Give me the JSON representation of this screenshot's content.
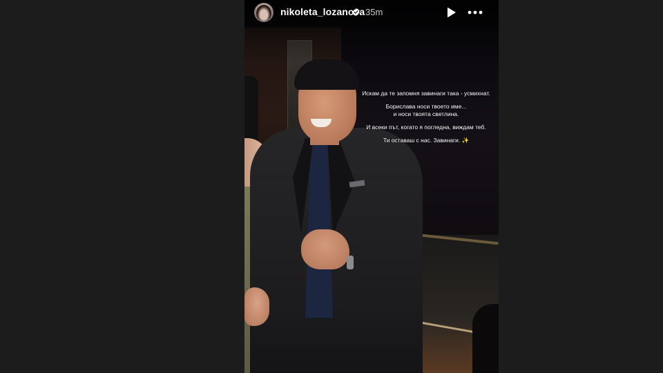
{
  "header": {
    "username": "nikoleta_lozanova",
    "verified_icon": "verified-badge-icon",
    "timestamp": "35m",
    "play_icon": "play-icon",
    "more_icon": "more-options-icon"
  },
  "caption": {
    "line1": "Искам да те запомня завинаги така - усмихнат.",
    "line2a": "Борислава носи твоето име...",
    "line2b": "и носи твоята светлина.",
    "line3": "И всеки път, когато я погледна, виждам теб.",
    "line4": "Ти оставаш с нас. Завинаги. ✨"
  },
  "colors": {
    "page_background": "#1c1c1c",
    "text": "#ffffff"
  }
}
